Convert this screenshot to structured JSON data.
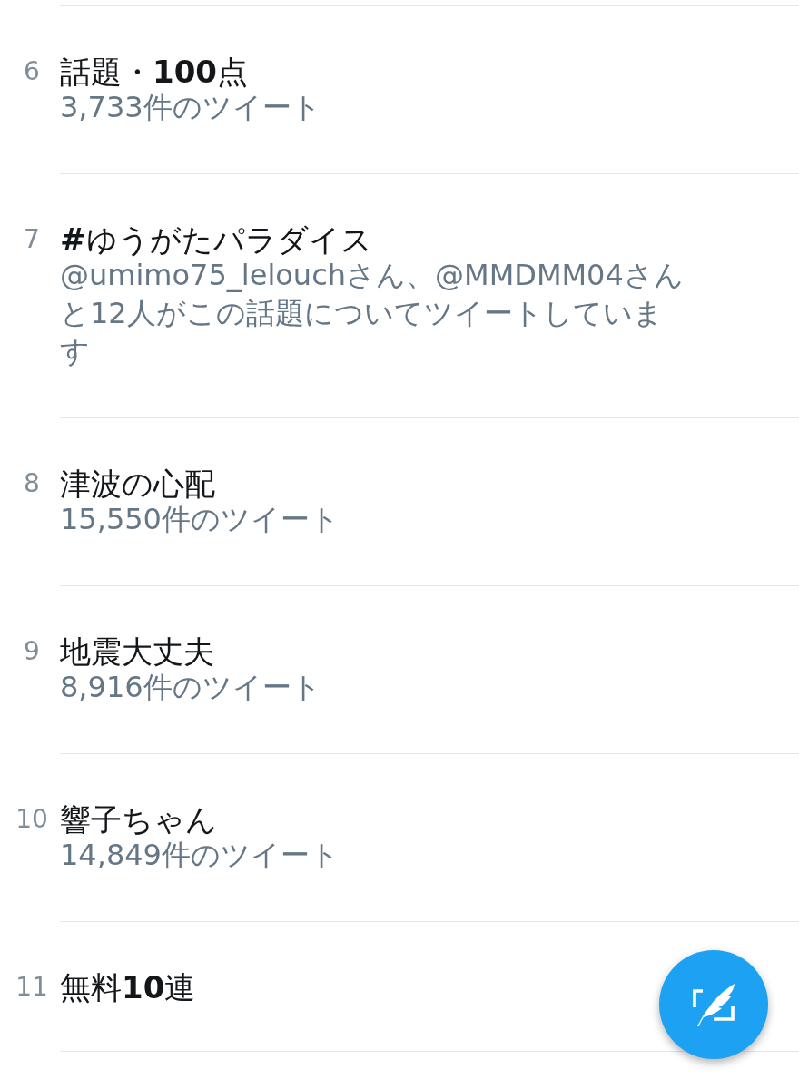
{
  "trends": [
    {
      "rank": "6",
      "title": "話題・**100**点",
      "subtitle": "3,733件のツイート"
    },
    {
      "rank": "7",
      "title": "**#**ゆうがたパラダイス",
      "subtitle": "@umimo75_lelouchさん、@MMDMM04さんと12人がこの話題についてツイートしています"
    },
    {
      "rank": "8",
      "title": "津波の心配",
      "subtitle": "15,550件のツイート"
    },
    {
      "rank": "9",
      "title": "地震大丈夫",
      "subtitle": "8,916件のツイート"
    },
    {
      "rank": "10",
      "title": "響子ちゃん",
      "subtitle": "14,849件のツイート"
    },
    {
      "rank": "11",
      "title": "無料**10**連"
    }
  ]
}
